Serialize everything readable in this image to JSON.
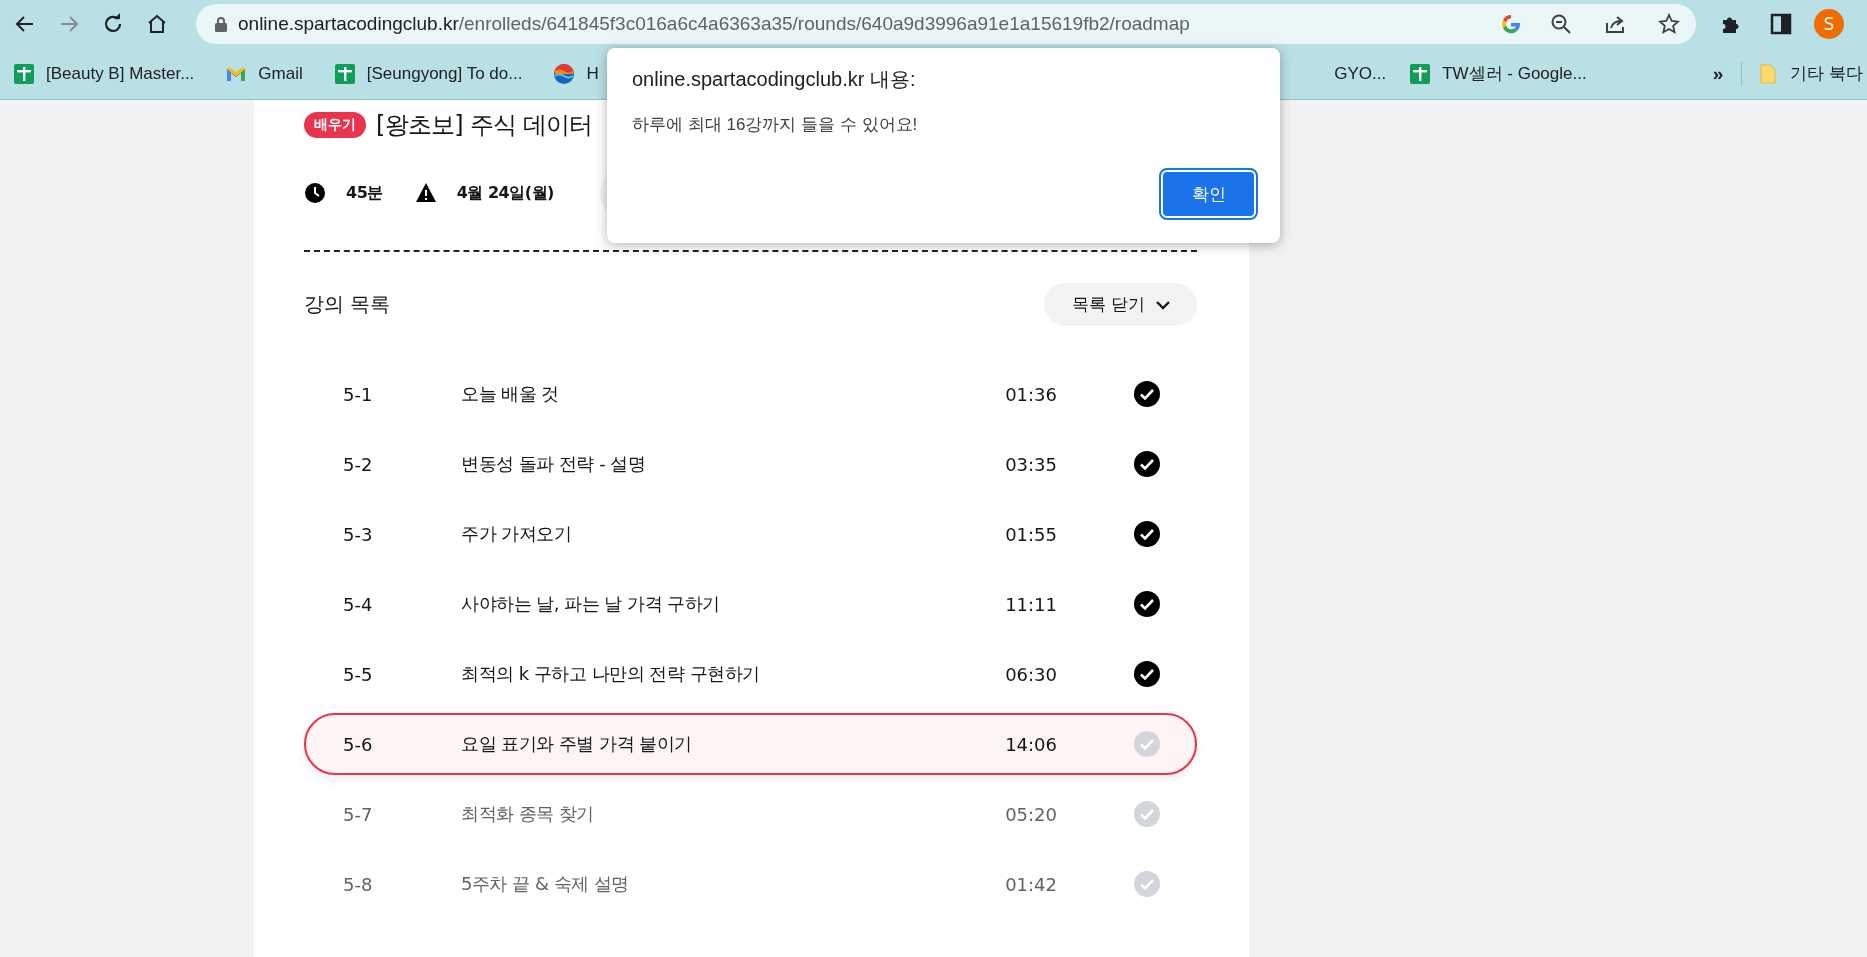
{
  "browser": {
    "url_host": "online.spartacodingclub.kr",
    "url_path": "/enrolleds/641845f3c016a6c4a6363a35/rounds/640a9d3996a91e1a15619fb2/roadmap",
    "profile_initial": "S"
  },
  "bookmarks_left": [
    {
      "label": "[Beauty B] Master...",
      "kind": "sheets"
    },
    {
      "label": "Gmail",
      "kind": "gmail"
    },
    {
      "label": "[Seungyong] To do...",
      "kind": "sheets"
    },
    {
      "label": "H",
      "kind": "globe"
    }
  ],
  "bookmarks_right": [
    {
      "label": "GYO...",
      "kind": "none"
    },
    {
      "label": "TW셀러 - Google...",
      "kind": "sheets"
    }
  ],
  "bookmarks_overflow": "»",
  "other_bookmarks": "기타 북다",
  "dialog": {
    "title": "online.spartacodingclub.kr 내용:",
    "message": "하루에 최대 16강까지 들을 수 있어요!",
    "button": "확인"
  },
  "course": {
    "badge": "배우기",
    "title": "[왕초보] 주식 데이터",
    "duration": "45분",
    "deadline": "4월 24일(월)"
  },
  "lessons": {
    "heading": "강의 목록",
    "toggle": "목록 닫기",
    "expanded": true,
    "rows": [
      {
        "number": "5-1",
        "title": "오늘 배울 것",
        "time": "01:36",
        "completed": true,
        "selected": false
      },
      {
        "number": "5-2",
        "title": "변동성 돌파 전략 - 설명",
        "time": "03:35",
        "completed": true,
        "selected": false
      },
      {
        "number": "5-3",
        "title": "주가 가져오기",
        "time": "01:55",
        "completed": true,
        "selected": false
      },
      {
        "number": "5-4",
        "title": "사야하는 날, 파는 날 가격 구하기",
        "time": "11:11",
        "completed": true,
        "selected": false
      },
      {
        "number": "5-5",
        "title": "최적의 k 구하고 나만의 전략 구현하기",
        "time": "06:30",
        "completed": true,
        "selected": false
      },
      {
        "number": "5-6",
        "title": "요일 표기와 주별 가격 붙이기",
        "time": "14:06",
        "completed": false,
        "selected": true
      },
      {
        "number": "5-7",
        "title": "최적화 종목 찾기",
        "time": "05:20",
        "completed": false,
        "selected": false
      },
      {
        "number": "5-8",
        "title": "5주차 끝 & 숙제 설명",
        "time": "01:42",
        "completed": false,
        "selected": false
      }
    ]
  }
}
